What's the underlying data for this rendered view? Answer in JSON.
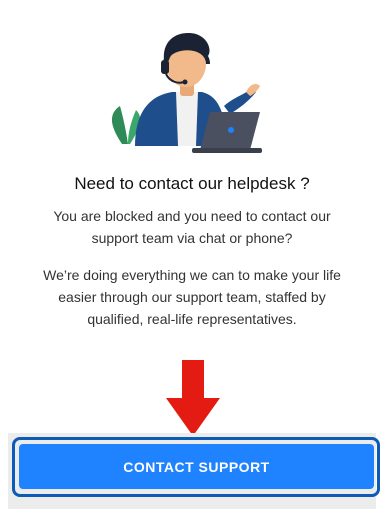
{
  "helpdesk": {
    "title": "Need to contact our helpdesk ?",
    "paragraph1": "You are blocked and you need to contact our\nsupport team via chat or phone?",
    "paragraph2": "We’re doing everything we can to make your life\neasier through our support team, staffed by\nqualified, real-life representatives."
  },
  "actions": {
    "contact_support_label": "CONTACT SUPPORT"
  },
  "illustration": {
    "icon": "support-agent-illustration",
    "colors": {
      "jacket": "#1f4e8c",
      "shirt": "#f1f1f1",
      "skin": "#f2b98a",
      "hair": "#1a2233",
      "laptop": "#4a5060",
      "plant": "#2e8b57",
      "accent_blue": "#1f82ff"
    }
  },
  "arrow": {
    "icon": "red-down-arrow",
    "color": "#e31b12"
  },
  "colors": {
    "button": "#1f82ff",
    "button_outline": "#0b5bb7",
    "footer_bg": "#ececec"
  }
}
